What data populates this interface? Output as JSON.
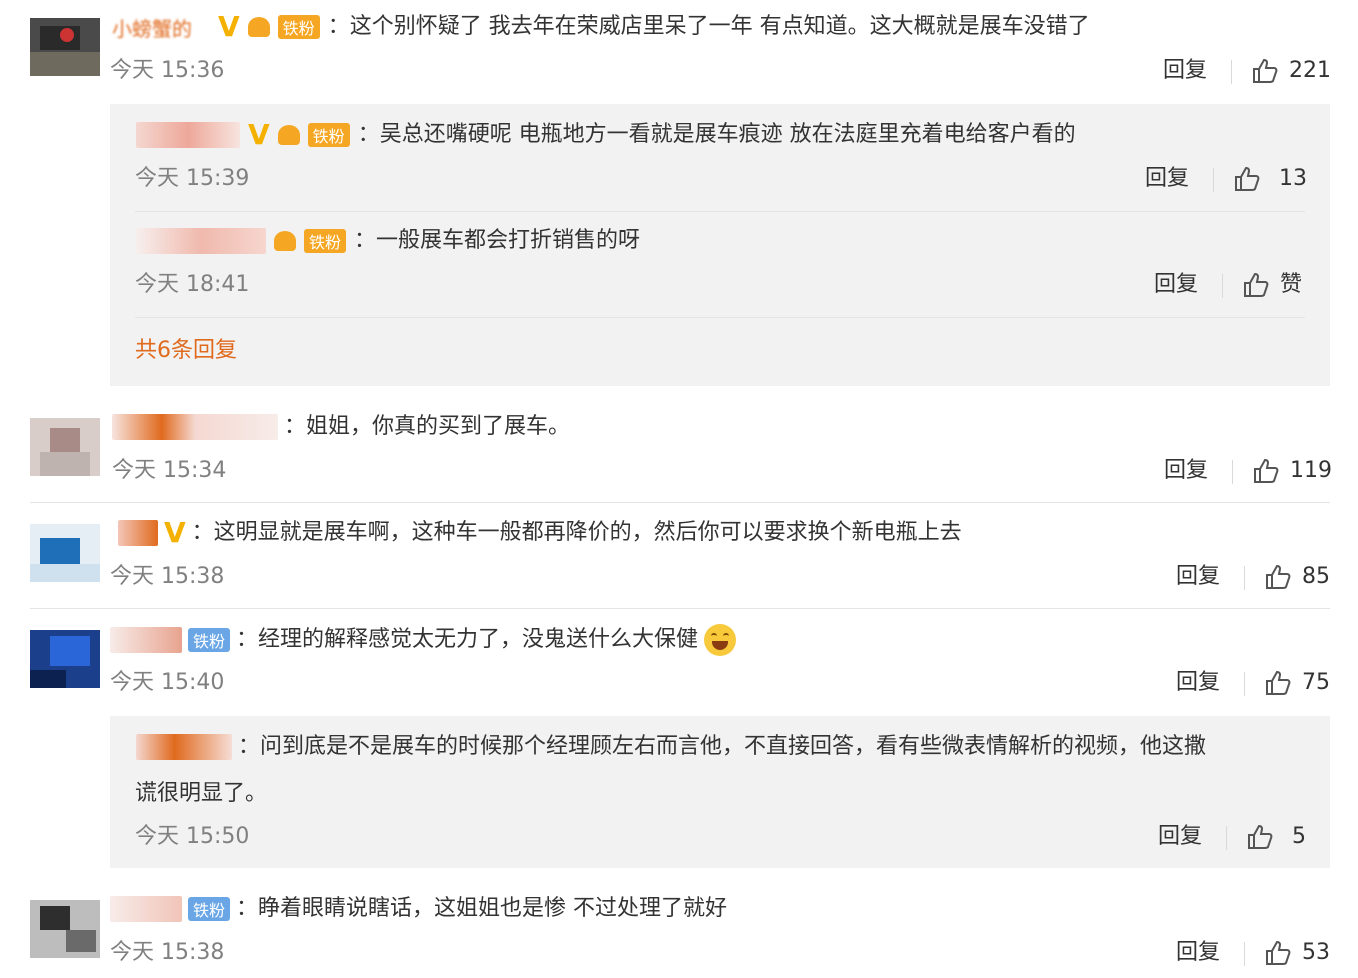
{
  "comments": [
    {
      "text": "：这个别怀疑了 我去年在荣威店里呆了一年 有点知道。这大概就是展车没错了",
      "name": "小螃蟹的",
      "badge": "铁粉",
      "time": "今天 15:36",
      "reply": "回复",
      "likes": "221"
    },
    {
      "text": "：姐姐，你真的买到了展车。",
      "time": "今天 15:34",
      "reply": "回复",
      "likes": "119"
    },
    {
      "text": "：这明显就是展车啊，这种车一般都再降价的，然后你可以要求换个新电瓶上去",
      "time": "今天 15:38",
      "reply": "回复",
      "likes": "85"
    },
    {
      "text": "：经理的解释感觉太无力了，没鬼送什么大保健",
      "badge": "铁粉",
      "time": "今天 15:40",
      "reply": "回复",
      "likes": "75"
    },
    {
      "text": "：睁着眼睛说瞎话，这姐姐也是惨 不过处理了就好",
      "badge": "铁粉",
      "time": "今天 15:38",
      "reply": "回复",
      "likes": "53"
    }
  ],
  "sub_replies": [
    {
      "text": "：吴总还嘴硬呢 电瓶地方一看就是展车痕迹 放在法庭里充着电给客户看的",
      "badge": "铁粉",
      "time": "今天 15:39",
      "reply": "回复",
      "likes": "13"
    },
    {
      "text": "：一般展车都会打折销售的呀",
      "badge": "铁粉",
      "time": "今天 18:41",
      "reply": "回复",
      "likes": "赞"
    },
    {
      "text_line1": "：问到底是不是展车的时候那个经理顾左右而言他，不直接回答，看有些微表情解析的视频，他这撒",
      "text_line2": "谎很明显了。",
      "time": "今天 15:50",
      "reply": "回复",
      "likes": "5"
    }
  ],
  "more_replies": "共6条回复",
  "colors": {
    "orange": "#e06a1e",
    "gold_badge": "#f5a623",
    "blue_badge": "#6aa6e6",
    "thread_bg": "#f2f2f2"
  },
  "icons": {
    "like": "thumbs-up-icon",
    "vip": "vip-v-icon",
    "crown": "fan-crown-icon",
    "emoji": "laugh-tears-emoji"
  }
}
